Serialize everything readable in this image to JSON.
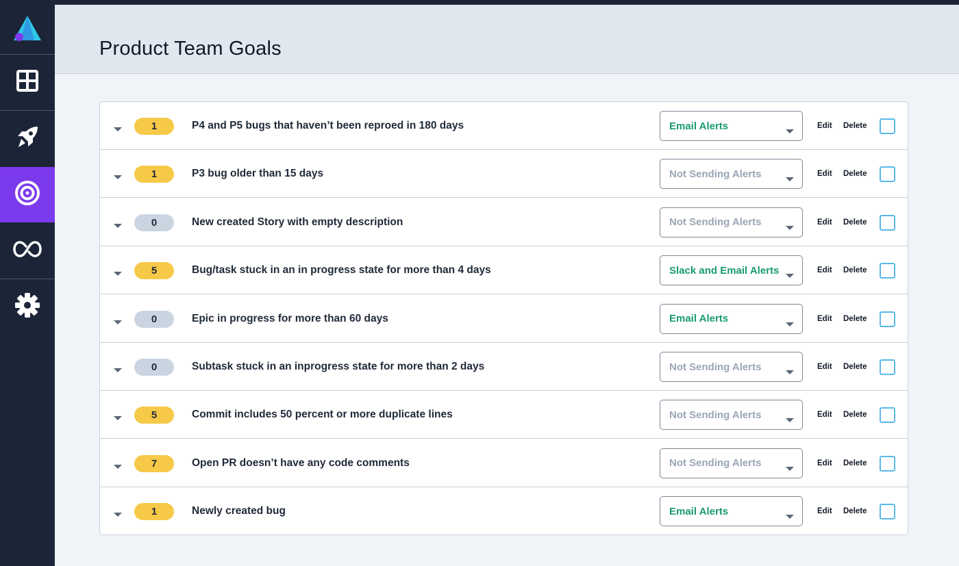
{
  "page": {
    "title": "Product Team Goals"
  },
  "sidebar": {
    "items": [
      {
        "name": "logo",
        "icon": "logo-icon"
      },
      {
        "name": "dashboard",
        "icon": "grid-icon"
      },
      {
        "name": "launch",
        "icon": "rocket-icon"
      },
      {
        "name": "goals",
        "icon": "target-icon",
        "active": true
      },
      {
        "name": "cycles",
        "icon": "loop-icon"
      },
      {
        "name": "settings",
        "icon": "gear-icon"
      }
    ],
    "active_color": "#7c3aed"
  },
  "actions": {
    "edit_label": "Edit",
    "delete_label": "Delete"
  },
  "colors": {
    "badge_active": "#f7c948",
    "badge_zero": "#cbd5e1",
    "alert_on": "#199b6e",
    "alert_off": "#9aa5b5",
    "checkbox_border": "#5ab8e8"
  },
  "goals": [
    {
      "count": "1",
      "text": "P4 and P5 bugs that haven’t been reproed in 180 days",
      "alert": "Email Alerts",
      "alert_on": true
    },
    {
      "count": "1",
      "text": "P3 bug older than 15 days",
      "alert": "Not Sending Alerts",
      "alert_on": false
    },
    {
      "count": "0",
      "text": "New created Story with empty description",
      "alert": "Not Sending Alerts",
      "alert_on": false
    },
    {
      "count": "5",
      "text": "Bug/task stuck in an in progress state for more than 4 days",
      "alert": "Slack and Email Alerts",
      "alert_on": true
    },
    {
      "count": "0",
      "text": "Epic in progress for more than 60 days",
      "alert": "Email Alerts",
      "alert_on": true
    },
    {
      "count": "0",
      "text": "Subtask stuck in an inprogress state for more than 2 days",
      "alert": "Not Sending Alerts",
      "alert_on": false
    },
    {
      "count": "5",
      "text": "Commit includes 50 percent or more duplicate lines",
      "alert": "Not Sending Alerts",
      "alert_on": false
    },
    {
      "count": "7",
      "text": "Open PR doesn’t have any code comments",
      "alert": "Not Sending Alerts",
      "alert_on": false
    },
    {
      "count": "1",
      "text": "Newly created bug",
      "alert": "Email Alerts",
      "alert_on": true
    }
  ]
}
